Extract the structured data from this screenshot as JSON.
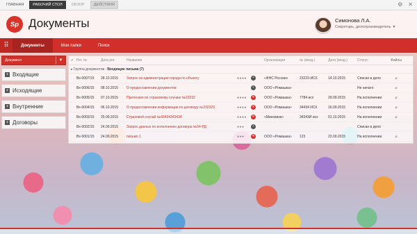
{
  "topbar": {
    "tabs": [
      {
        "label": "ГЛАВНАЯ",
        "style": "normal"
      },
      {
        "label": "РАБОЧИЙ СТОЛ",
        "style": "dark"
      },
      {
        "label": "ОБЗОР",
        "style": "gray"
      },
      {
        "label": "ДЕЙСТВИЯ",
        "style": "sel"
      }
    ],
    "icons": [
      "gear-icon",
      "close-icon"
    ]
  },
  "header": {
    "logo_text": "Sp",
    "title": "Документы",
    "user_name": "Симонова Л.А.",
    "user_role": "Секретарь, делопроизводитель"
  },
  "nav": {
    "tabs": [
      "Документы",
      "Мои папки",
      "Поиск"
    ]
  },
  "sidebar": {
    "select_value": "Документ",
    "buttons": [
      "Входящие",
      "Исходящие",
      "Внутренние",
      "Договоры"
    ]
  },
  "table": {
    "columns": [
      "Рег. №",
      "Дата рег.",
      "Название",
      "Организация",
      "№ (вход.)",
      "Дата (вход.)",
      "Статус",
      "Файлы"
    ],
    "group_prefix": "Группа документов :",
    "group_name": "Входящие письма (7)",
    "rows": [
      {
        "num": "Вх-0007/15",
        "date": "28.10.2015",
        "name": "Запрос из администрации города по объекту",
        "dots": "●●●●",
        "icon": "k",
        "org": "«ФНС России»",
        "in_num": "23223-ИСХ",
        "in_date": "14.10.2015",
        "status": "Списан в дело",
        "file": true
      },
      {
        "num": "Вх-0006/15",
        "date": "08.10.2015",
        "name": "О предоставлении документов",
        "dots": "",
        "icon": "k",
        "org": "ООО «Ромашка»",
        "in_num": "",
        "in_date": "",
        "status": "Не начато",
        "file": true
      },
      {
        "num": "Вх-0005/15",
        "date": "07.10.2015",
        "name": "Претензия по страховому случаю №23232",
        "dots": "●●●●",
        "icon": "x",
        "org": "ООО «Ромашка»",
        "in_num": "7784 исх",
        "in_date": "29.09.2015",
        "status": "На исполнении",
        "file": true
      },
      {
        "num": "Вх-0004/15",
        "date": "06.10.2015",
        "name": "О предоставлении информации по договору №232323",
        "dots": "●●●●",
        "icon": "x",
        "org": "ООО «Ромашка»",
        "in_num": "34434 ИСХ",
        "in_date": "16.09.2015",
        "status": "На исполнении",
        "file": true
      },
      {
        "num": "Вх-0003/15",
        "date": "25.09.2015",
        "name": "Страховой случай №43434343434",
        "dots": "●●●●",
        "icon": "x",
        "org": "«Минсвязи»",
        "in_num": "34343И исх",
        "in_date": "01.10.2015",
        "status": "На исполнении",
        "file": true
      },
      {
        "num": "Вх-0002/15",
        "date": "24.09.2015",
        "name": "Запрос данных по исполнению договора №54-РД",
        "dots": "●●●",
        "icon": "k",
        "org": "",
        "in_num": "",
        "in_date": "",
        "status": "Списан в дело",
        "file": false
      },
      {
        "num": "Вх-0001/15",
        "date": "24.09.2015",
        "name": "письмо 1",
        "dots": "●●●",
        "icon": "x",
        "org": "ООО «Ромашка»",
        "in_num": "123",
        "in_date": "23.09.2015",
        "status": "На исполнении",
        "file": true
      }
    ]
  },
  "colors": {
    "accent": "#d1302a",
    "dark": "#3a3a3a"
  }
}
